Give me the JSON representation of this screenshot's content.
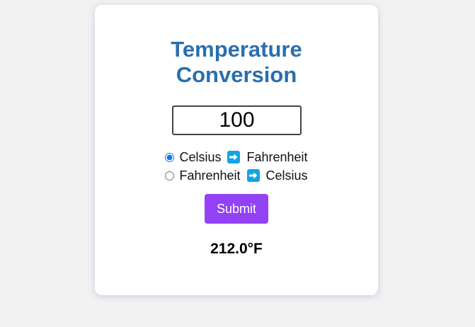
{
  "title": {
    "line1": "Temperature",
    "line2": "Conversion"
  },
  "input": {
    "value": "100"
  },
  "options": [
    {
      "from": "Celsius",
      "to": "Fahrenheit",
      "selected": true
    },
    {
      "from": "Fahrenheit",
      "to": "Celsius",
      "selected": false
    }
  ],
  "submit_label": "Submit",
  "result": "212.0°F",
  "colors": {
    "title": "#2a6ead",
    "button": "#9241f5",
    "arrow": "#14a3e3"
  },
  "icons": {
    "direction": "right-arrow-icon"
  }
}
